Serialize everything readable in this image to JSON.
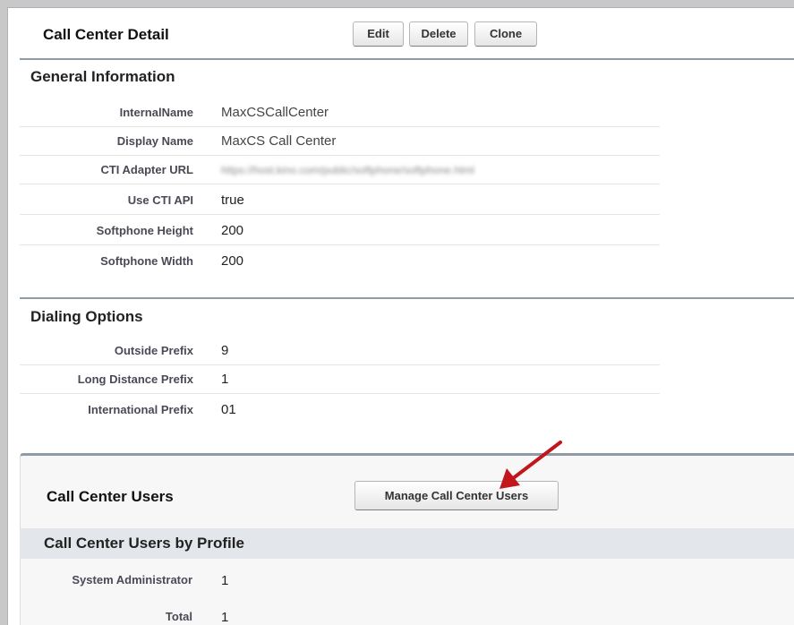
{
  "detail": {
    "title": "Call Center Detail",
    "buttons": {
      "edit": "Edit",
      "delete": "Delete",
      "clone": "Clone"
    }
  },
  "general_information": {
    "header": "General Information",
    "fields": [
      {
        "label": "InternalName",
        "value": "MaxCSCallCenter"
      },
      {
        "label": "Display Name",
        "value": "MaxCS Call Center"
      },
      {
        "label": "CTI Adapter URL",
        "value": "https://host.kino.com/public/softphone/softphone.html"
      },
      {
        "label": "Use CTI API",
        "value": "true"
      },
      {
        "label": "Softphone Height",
        "value": "200"
      },
      {
        "label": "Softphone Width",
        "value": "200"
      }
    ]
  },
  "dialing_options": {
    "header": "Dialing Options",
    "fields": [
      {
        "label": "Outside Prefix",
        "value": "9"
      },
      {
        "label": "Long Distance Prefix",
        "value": "1"
      },
      {
        "label": "International Prefix",
        "value": "01"
      }
    ]
  },
  "call_center_users": {
    "title": "Call Center Users",
    "manage_button": "Manage Call Center Users",
    "by_profile_header": "Call Center Users by Profile",
    "rows": [
      {
        "label": "System Administrator",
        "value": "1"
      },
      {
        "label": "Total",
        "value": "1"
      }
    ]
  },
  "annotation": {
    "arrow_color": "#c0161c"
  }
}
